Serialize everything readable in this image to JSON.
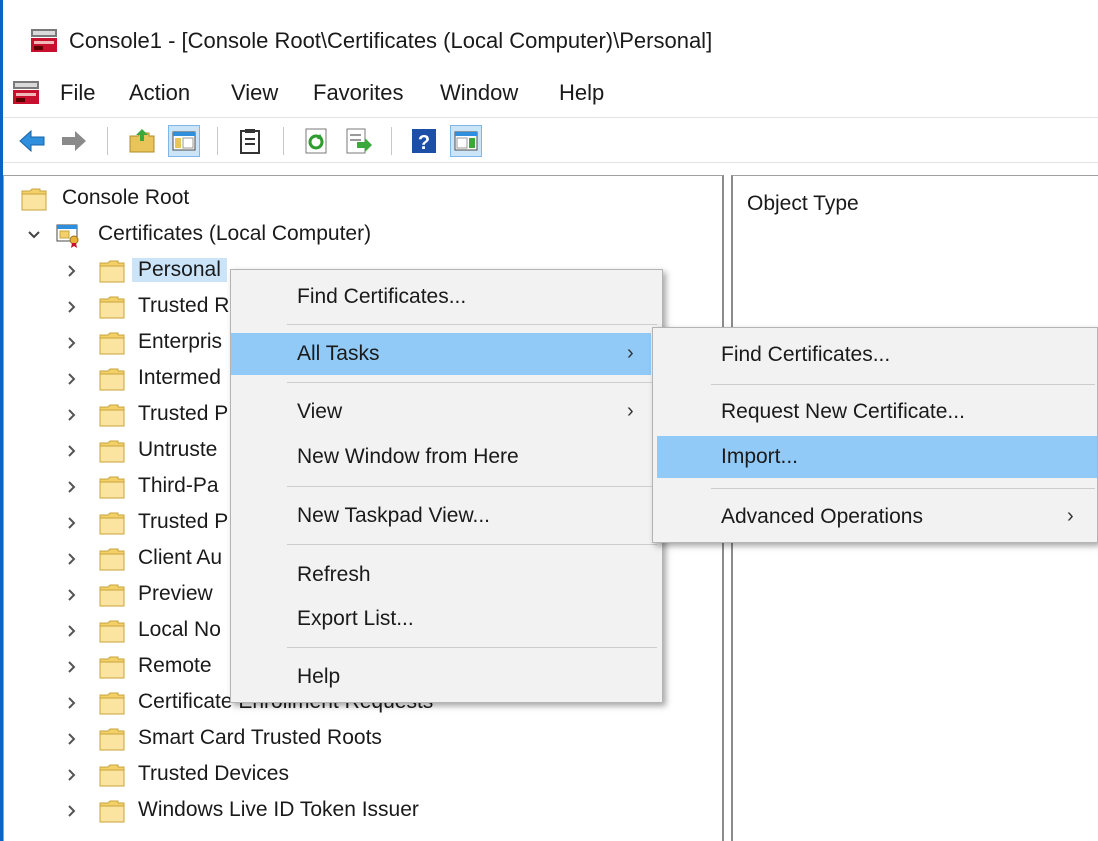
{
  "window": {
    "title": "Console1 - [Console Root\\Certificates (Local Computer)\\Personal]"
  },
  "menubar": {
    "items": [
      "File",
      "Action",
      "View",
      "Favorites",
      "Window",
      "Help"
    ]
  },
  "toolbar": {
    "buttons": [
      "back-icon",
      "forward-icon",
      "up-folder-icon",
      "show-hide-tree-icon",
      "properties-icon",
      "refresh-icon",
      "export-list-icon",
      "help-icon",
      "show-hide-action-pane-icon"
    ]
  },
  "tree": {
    "root": "Console Root",
    "certs": "Certificates (Local Computer)",
    "items": [
      "Personal",
      "Trusted R",
      "Enterpris",
      "Intermed",
      "Trusted P",
      "Untruste",
      "Third-Pa",
      "Trusted P",
      "Client Au",
      "Preview",
      "Local No",
      "Remote",
      "Certificate Enrollment Requests",
      "Smart Card Trusted Roots",
      "Trusted Devices",
      "Windows Live ID Token Issuer"
    ]
  },
  "result_pane": {
    "column_header": "Object Type"
  },
  "context_menu": {
    "items": [
      "Find Certificates...",
      "All Tasks",
      "View",
      "New Window from Here",
      "New Taskpad View...",
      "Refresh",
      "Export List...",
      "Help"
    ]
  },
  "submenu": {
    "items": [
      "Find Certificates...",
      "Request New Certificate...",
      "Import...",
      "Advanced Operations"
    ]
  },
  "arrow_glyph": "›",
  "colors": {
    "highlight": "#91c9f7",
    "selection": "#cce4f7",
    "menu_bg": "#f2f2f2"
  }
}
